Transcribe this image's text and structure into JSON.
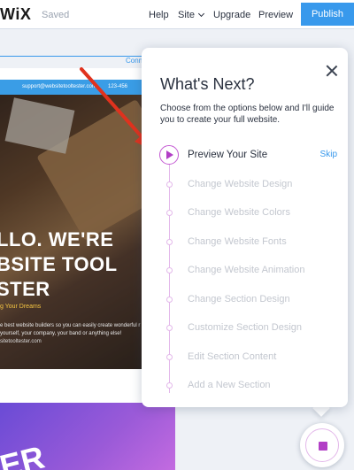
{
  "topbar": {
    "logo": "WiX",
    "status": "Saved",
    "nav": {
      "help": "Help",
      "site": "Site",
      "upgrade": "Upgrade",
      "preview": "Preview"
    },
    "publish_label": "Publish"
  },
  "site_preview": {
    "connect_text": "Conn",
    "email": "support@websitetooltester.com",
    "phone": "123-456",
    "hero_title": "LLO. WE'RE\nBSITE TOOL\nSTER",
    "hero_sub": "g Your Dreams",
    "hero_body": "e best website builders so you can easily create wonderful r yourself, your company, your band or anything else!",
    "hero_link": "sitetooltester.com",
    "purple_text": "ER"
  },
  "panel": {
    "title": "What's Next?",
    "description": "Choose from the options below and I'll guide you to create your full website.",
    "skip_label": "Skip",
    "steps": [
      {
        "label": "Preview Your Site",
        "active": true
      },
      {
        "label": "Change Website Design",
        "active": false
      },
      {
        "label": "Change Website Colors",
        "active": false
      },
      {
        "label": "Change Website Fonts",
        "active": false
      },
      {
        "label": "Change Website Animation",
        "active": false
      },
      {
        "label": "Change Section Design",
        "active": false
      },
      {
        "label": "Customize Section Design",
        "active": false
      },
      {
        "label": "Edit Section Content",
        "active": false
      },
      {
        "label": "Add a New Section",
        "active": false
      }
    ]
  },
  "colors": {
    "accent": "#3899ec",
    "wizard_purple": "#b23fc6",
    "arrow_red": "#e0321e"
  },
  "icons": {
    "close": "close-icon",
    "play": "play-icon",
    "chevron": "chevron-down-icon",
    "fab": "stop-square-icon"
  }
}
